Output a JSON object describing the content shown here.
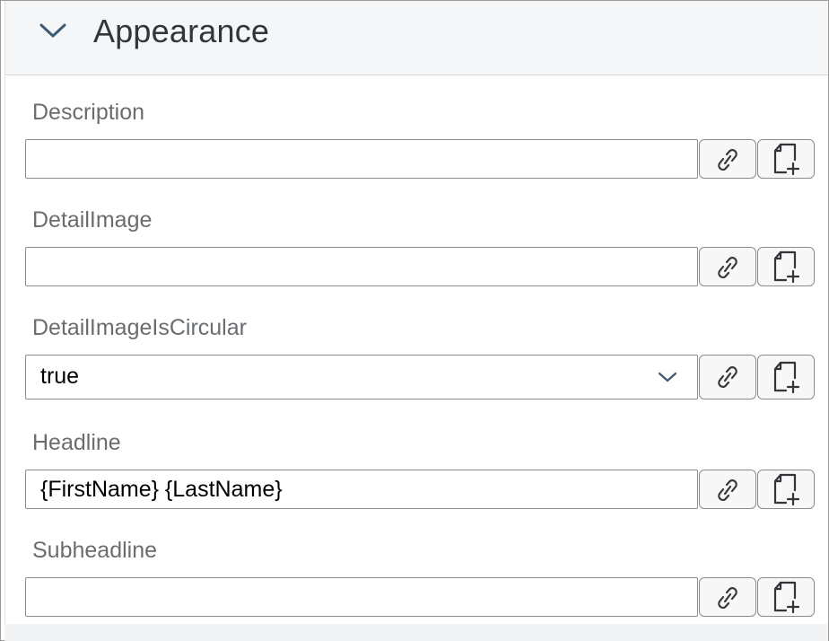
{
  "panel": {
    "title": "Appearance",
    "collapsed": false
  },
  "fields": [
    {
      "label": "Description",
      "type": "text",
      "value": ""
    },
    {
      "label": "DetailImage",
      "type": "text",
      "value": ""
    },
    {
      "label": "DetailImageIsCircular",
      "type": "select",
      "value": "true"
    },
    {
      "label": "Headline",
      "type": "text",
      "value": "{FirstName} {LastName}"
    },
    {
      "label": "Subheadline",
      "type": "text",
      "value": ""
    }
  ],
  "icons": {
    "collapse": "chevron-down-icon",
    "select_arrow": "chevron-down-icon",
    "bind": "link-icon",
    "create": "new-document-icon"
  },
  "colors": {
    "header_bg": "#f5f6f7",
    "label": "#6a6d70",
    "title": "#32363a",
    "accent": "#0a6ed1"
  }
}
